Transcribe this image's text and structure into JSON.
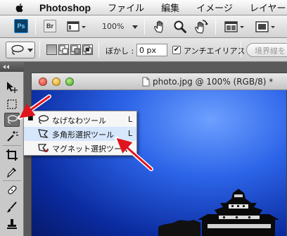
{
  "menubar": {
    "apple_icon": "apple-logo-icon",
    "app_name": "Photoshop",
    "items": [
      "ファイル",
      "編集",
      "イメージ",
      "レイヤー"
    ]
  },
  "appbar": {
    "ps_logo": "Ps",
    "bridge_logo": "Br",
    "zoom": "100%",
    "icons": [
      "screen-mode-icon",
      "hand-tool-icon",
      "zoom-tool-icon",
      "rotate-view-icon",
      "arrange-documents-icon",
      "screen-mode-menu-icon"
    ]
  },
  "options": {
    "feather_label": "ぼかし :",
    "feather_value": "0 px",
    "antialias_checked": true,
    "antialias_label": "アンチエイリアス",
    "refine_edge_label": "境界線を"
  },
  "document": {
    "title": "photo.jpg @ 100% (RGB/8) *"
  },
  "flyout": {
    "items": [
      {
        "label": "なげなわツール",
        "shortcut": "L",
        "active": true,
        "icon": "lasso-tool-icon"
      },
      {
        "label": "多角形選択ツール",
        "shortcut": "L",
        "active": false,
        "icon": "polygonal-lasso-tool-icon"
      },
      {
        "label": "マグネット選択ツール",
        "shortcut": "",
        "active": false,
        "icon": "magnetic-lasso-tool-icon"
      }
    ],
    "highlighted_index": 1
  },
  "colors": {
    "arrow": "#e0141e",
    "highlight": "#d6e6fb",
    "sky_blue": "#2c64e8"
  }
}
